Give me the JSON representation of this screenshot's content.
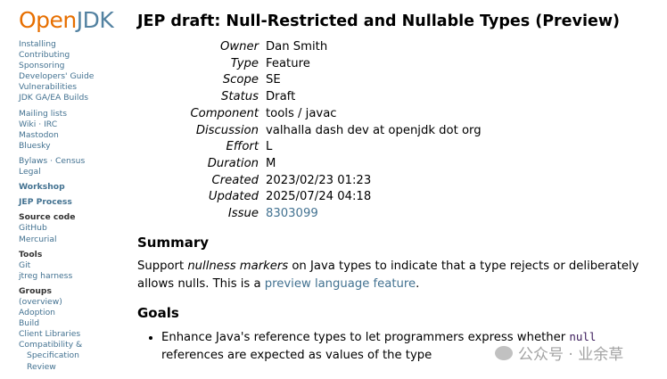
{
  "logo": {
    "open": "Open",
    "jdk": "JDK"
  },
  "sidebar": {
    "g1": [
      "Installing",
      "Contributing",
      "Sponsoring",
      "Developers' Guide",
      "Vulnerabilities",
      "JDK GA/EA Builds"
    ],
    "g2": [
      "Mailing lists",
      "Wiki · IRC",
      "Mastodon",
      "Bluesky"
    ],
    "g3": [
      "Bylaws · Census",
      "Legal"
    ],
    "workshop": "Workshop",
    "jep": "JEP Process",
    "source_h": "Source code",
    "source": [
      "GitHub",
      "Mercurial"
    ],
    "tools_h": "Tools",
    "tools": [
      "Git",
      "jtreg harness"
    ],
    "groups_h": "Groups",
    "groups": [
      "(overview)",
      "Adoption",
      "Build",
      "Client Libraries",
      "Compatibility &"
    ],
    "groups_cont": [
      "Specification",
      "Review"
    ]
  },
  "title": "JEP draft: Null-Restricted and Nullable Types (Preview)",
  "meta": [
    {
      "k": "Owner",
      "v": "Dan Smith"
    },
    {
      "k": "Type",
      "v": "Feature"
    },
    {
      "k": "Scope",
      "v": "SE"
    },
    {
      "k": "Status",
      "v": "Draft"
    },
    {
      "k": "Component",
      "v": "tools / javac"
    },
    {
      "k": "Discussion",
      "v": "valhalla dash dev at openjdk dot org"
    },
    {
      "k": "Effort",
      "v": "L"
    },
    {
      "k": "Duration",
      "v": "M"
    },
    {
      "k": "Created",
      "v": "2023/02/23 01:23"
    },
    {
      "k": "Updated",
      "v": "2025/07/24 04:18"
    },
    {
      "k": "Issue",
      "v": "8303099"
    }
  ],
  "summary": {
    "heading": "Summary",
    "t1": "Support ",
    "em": "nullness markers",
    "t2": " on Java types to indicate that a type rejects or deliberately allows nulls. This is a ",
    "link": "preview language feature",
    "t3": "."
  },
  "goals": {
    "heading": "Goals",
    "b1": "Enhance Java's reference types to let programmers express whether ",
    "code": "null",
    "b2": " references are expected as values of the type"
  },
  "watermark": "公众号 · 业余草"
}
